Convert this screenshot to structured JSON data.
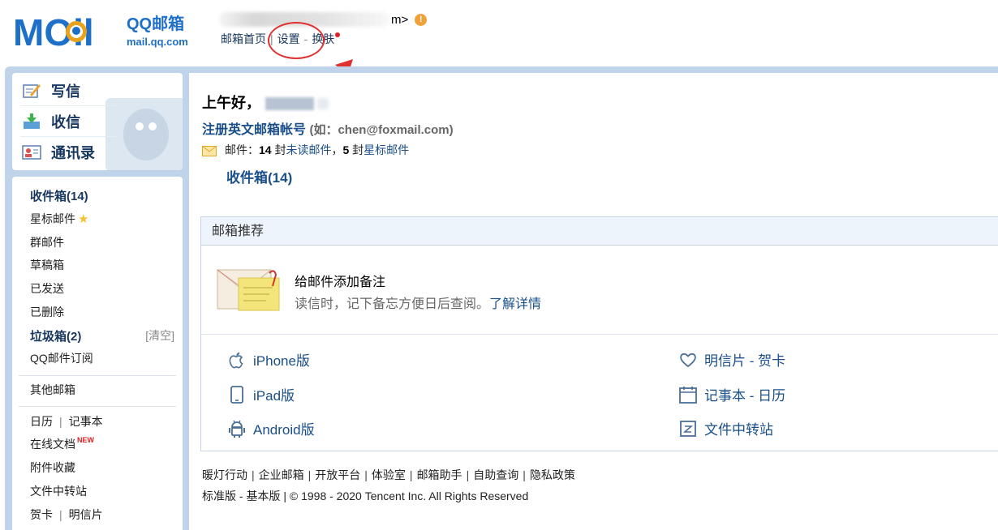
{
  "header": {
    "logo_text": "MOil",
    "logo_brand": "QQ邮箱",
    "logo_domain": "mail.qq.com",
    "user_suffix": "m>",
    "links": {
      "home": "邮箱首页",
      "separator": "|",
      "settings": "设置",
      "dash": "-",
      "skin": "换肤"
    },
    "accent_color": "#1a4f8a",
    "annotation_color": "#e03030"
  },
  "sidebar": {
    "compose": "写信",
    "inbox_receive": "收信",
    "contacts": "通讯录",
    "items": {
      "inbox": "收件箱(14)",
      "starred": "星标邮件",
      "group": "群邮件",
      "drafts": "草稿箱",
      "sent": "已发送",
      "deleted": "已删除",
      "spam": "垃圾箱(2)",
      "spam_clear": "[清空]",
      "subscribe": "QQ邮件订阅",
      "other_mail": "其他邮箱",
      "calendar": "日历",
      "notes": "记事本",
      "separator": "|",
      "online_docs": "在线文档",
      "new_badge": "NEW",
      "attachments": "附件收藏",
      "file_transfer": "文件中转站",
      "cards": "贺卡",
      "postcards": "明信片"
    }
  },
  "main": {
    "greeting": "上午好，",
    "register_link": "注册英文邮箱帐号",
    "register_hint": "(如：chen@foxmail.com)",
    "mail_label": "邮件：",
    "unread_count": "14",
    "unread_unit": "封",
    "unread_link": "未读邮件",
    "comma": "，",
    "starred_count": "5",
    "starred_unit": "封",
    "starred_link": "星标邮件",
    "inbox_link": "收件箱(14)",
    "recommend": {
      "title": "邮箱推荐",
      "feature_title": "给邮件添加备注",
      "feature_desc": "读信时，记下备忘方便日后查阅。",
      "feature_more": "了解详情",
      "apps": {
        "iphone": "iPhone版",
        "ipad": "iPad版",
        "android": "Android版",
        "postcard": "明信片 - 贺卡",
        "notebook": "记事本 - 日历",
        "file_transfer": "文件中转站"
      }
    },
    "footer": {
      "links": [
        "暖灯行动",
        "企业邮箱",
        "开放平台",
        "体验室",
        "邮箱助手",
        "自助查询",
        "隐私政策"
      ],
      "separator": "|",
      "standard": "标准版",
      "dash": "-",
      "basic": "基本版",
      "copyright": "© 1998 - 2020 Tencent Inc. All Rights Reserved"
    }
  }
}
